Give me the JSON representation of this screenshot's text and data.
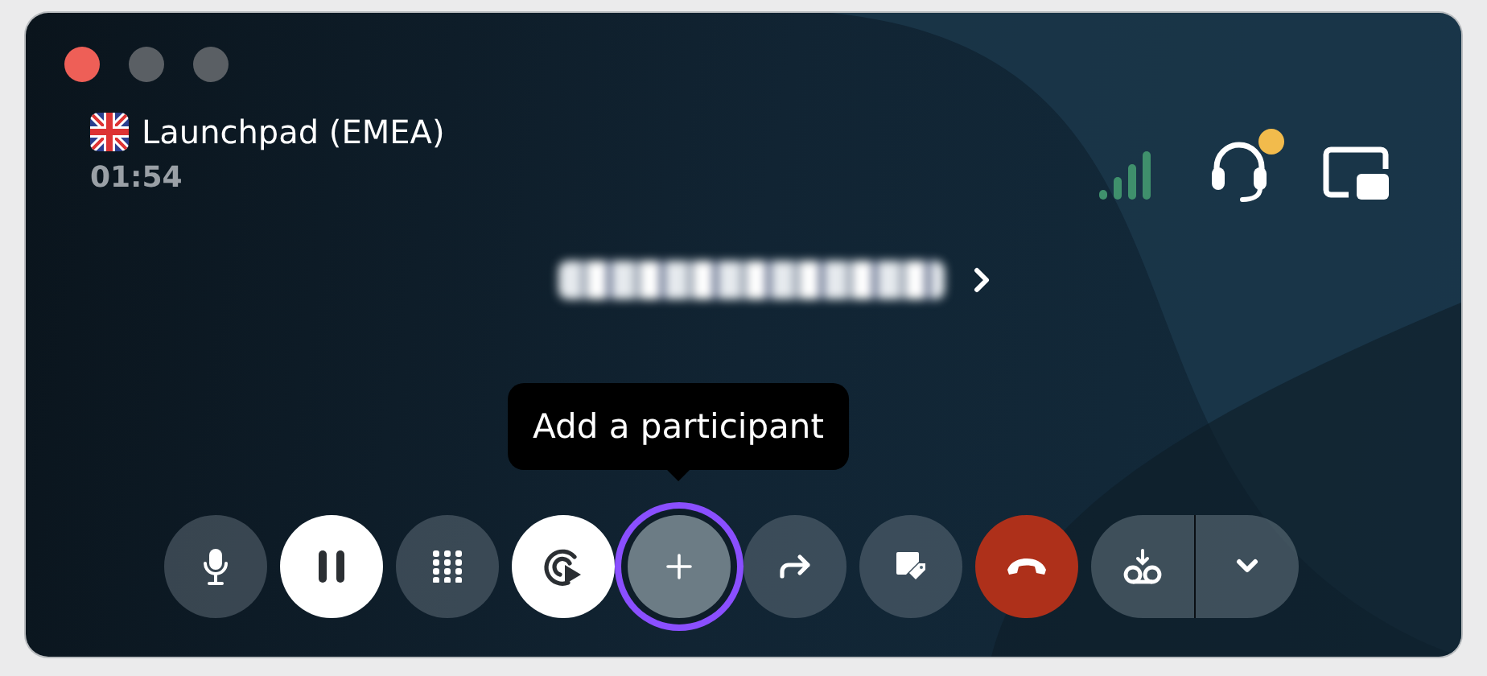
{
  "call": {
    "line": "Launchpad (EMEA)",
    "duration": "01:54",
    "number_redacted": true
  },
  "status": {
    "headset_alert": true
  },
  "tooltip": "Add a participant",
  "buttons": [
    {
      "kind": "mic",
      "active": false,
      "focused": false
    },
    {
      "kind": "pause",
      "active": true,
      "focused": false
    },
    {
      "kind": "keypad",
      "active": false,
      "focused": false
    },
    {
      "kind": "record",
      "active": true,
      "focused": false
    },
    {
      "kind": "add",
      "active": false,
      "focused": true
    },
    {
      "kind": "transfer",
      "active": false,
      "focused": false
    },
    {
      "kind": "tag",
      "active": false,
      "focused": false
    },
    {
      "kind": "hangup",
      "active": false,
      "focused": false
    },
    {
      "kind": "voicemail",
      "active": false,
      "focused": false
    },
    {
      "kind": "more",
      "active": false,
      "focused": false
    }
  ]
}
